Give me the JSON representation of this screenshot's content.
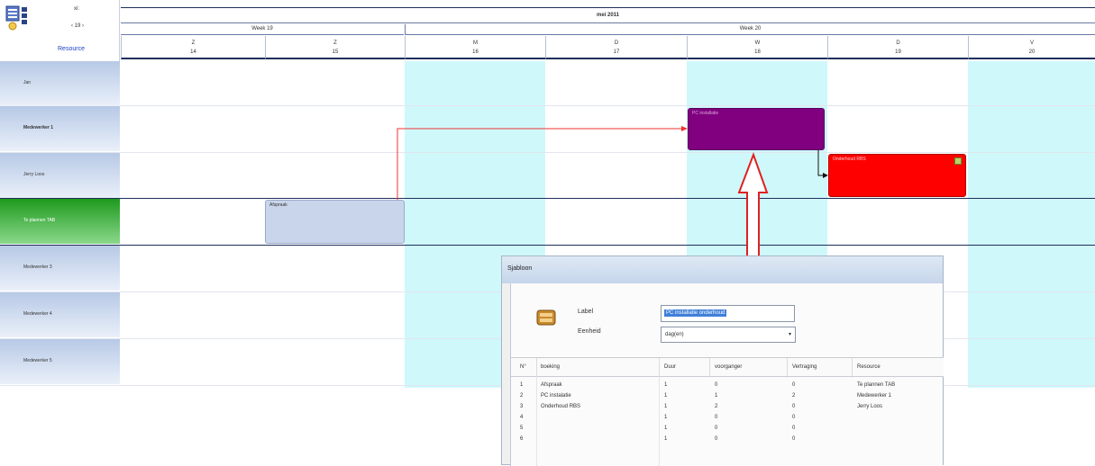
{
  "corner": {
    "zoom_label": "xi:",
    "count_label": "‹ 19 ›",
    "resource_label": "Resource"
  },
  "header": {
    "month": "mei 2011",
    "weeks": [
      "Week 19",
      "Week 20"
    ],
    "days": [
      {
        "name": "Z",
        "num": "14"
      },
      {
        "name": "Z",
        "num": "15"
      },
      {
        "name": "M",
        "num": "16"
      },
      {
        "name": "D",
        "num": "17"
      },
      {
        "name": "W",
        "num": "18"
      },
      {
        "name": "D",
        "num": "19"
      },
      {
        "name": "V",
        "num": "20"
      }
    ]
  },
  "rows": [
    "Jan",
    "Medewerker 1",
    "Jerry Loos",
    "Te plannen TAB",
    "Medewerker 3",
    "Medewerker 4",
    "Medewerker 5"
  ],
  "bookings": {
    "afspraak": "Afspraak",
    "pc_installatie": "PC installatie",
    "onderhoud": "Onderhoud RBS"
  },
  "colors": {
    "accent_purple": "#800080",
    "accent_red": "#ff0000",
    "band_cyan": "#cff8fb",
    "green": "#1e9a1e"
  },
  "dialog": {
    "title": "Sjabloon",
    "label_caption": "Label",
    "label_value": "PC installatie onderhoud",
    "eenheid_caption": "Eenheid",
    "eenheid_value": "dag(en)",
    "columns": [
      "N°",
      "boeking",
      "Duur",
      "voorganger",
      "Vertraging",
      "Resource"
    ],
    "rows": [
      [
        "1",
        "Afspraak",
        "1",
        "0",
        "0",
        "Te plannen TAB"
      ],
      [
        "2",
        "PC instalatie",
        "1",
        "1",
        "2",
        "Medewerker 1"
      ],
      [
        "3",
        "Onderhoud RBS",
        "1",
        "2",
        "0",
        "Jerry Loos"
      ],
      [
        "4",
        "",
        "1",
        "0",
        "0",
        ""
      ],
      [
        "5",
        "",
        "1",
        "0",
        "0",
        ""
      ],
      [
        "6",
        "",
        "1",
        "0",
        "0",
        ""
      ]
    ]
  }
}
